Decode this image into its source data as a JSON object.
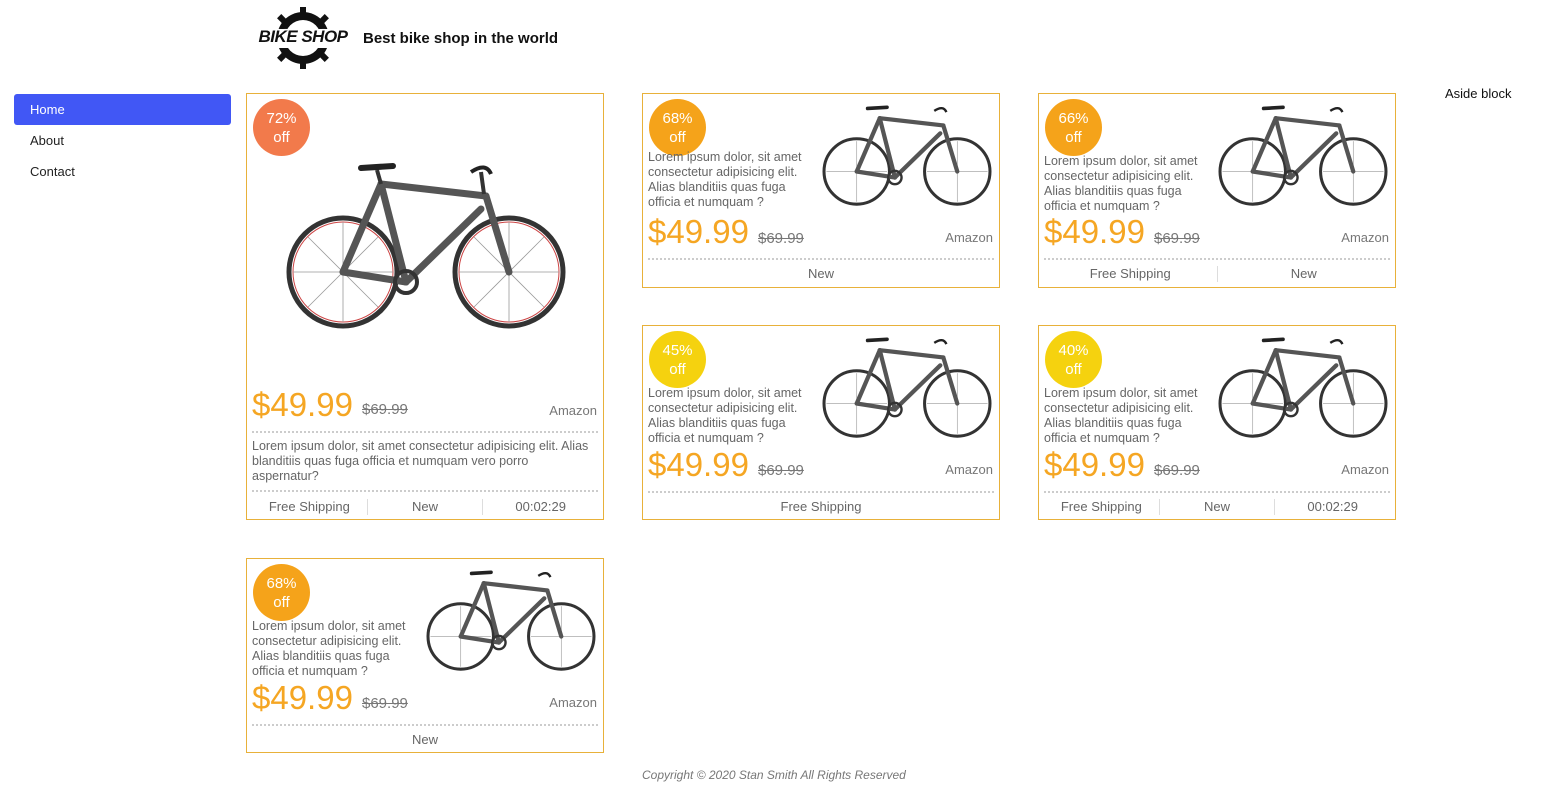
{
  "header": {
    "logo_text": "BIKE SHOP",
    "tagline": "Best bike shop in the world"
  },
  "nav": {
    "items": [
      {
        "label": "Home",
        "active": true
      },
      {
        "label": "About",
        "active": false
      },
      {
        "label": "Contact",
        "active": false
      }
    ]
  },
  "aside": {
    "label": "Aside block"
  },
  "colors": {
    "accent_blue": "#4157f5",
    "price_orange": "#f5a623",
    "card_border": "#e8b13a",
    "badge_72": "#f27a4b",
    "badge_68": "#f5a31a",
    "badge_66": "#f5a31a",
    "badge_45": "#f5d20f",
    "badge_40": "#f5d20f"
  },
  "cards": [
    {
      "badge_pct": "72%",
      "badge_off": "off",
      "price": "$49.99",
      "old_price": "$69.99",
      "store": "Amazon",
      "desc": "Lorem ipsum dolor, sit amet consectetur adipisicing elit. Alias blanditiis quas fuga officia et numquam vero porro aspernatur?",
      "tags": [
        "Free Shipping",
        "New",
        "00:02:29"
      ]
    },
    {
      "badge_pct": "68%",
      "badge_off": "off",
      "price": "$49.99",
      "old_price": "$69.99",
      "store": "Amazon",
      "desc": "Lorem ipsum dolor, sit amet consectetur adipisicing elit. Alias blanditiis quas fuga officia et numquam ?",
      "tags": [
        "New"
      ]
    },
    {
      "badge_pct": "66%",
      "badge_off": "off",
      "price": "$49.99",
      "old_price": "$69.99",
      "store": "Amazon",
      "desc": "Lorem ipsum dolor, sit amet consectetur adipisicing elit. Alias blanditiis quas fuga officia et numquam ?",
      "tags": [
        "Free Shipping",
        "New"
      ]
    },
    {
      "badge_pct": "45%",
      "badge_off": "off",
      "price": "$49.99",
      "old_price": "$69.99",
      "store": "Amazon",
      "desc": "Lorem ipsum dolor, sit amet consectetur adipisicing elit. Alias blanditiis quas fuga officia et numquam ?",
      "tags": [
        "Free Shipping"
      ]
    },
    {
      "badge_pct": "40%",
      "badge_off": "off",
      "price": "$49.99",
      "old_price": "$69.99",
      "store": "Amazon",
      "desc": "Lorem ipsum dolor, sit amet consectetur adipisicing elit. Alias blanditiis quas fuga officia et numquam ?",
      "tags": [
        "Free Shipping",
        "New",
        "00:02:29"
      ]
    },
    {
      "badge_pct": "68%",
      "badge_off": "off",
      "price": "$49.99",
      "old_price": "$69.99",
      "store": "Amazon",
      "desc": "Lorem ipsum dolor, sit amet consectetur adipisicing elit. Alias blanditiis quas fuga officia et numquam ?",
      "tags": [
        "New"
      ]
    }
  ],
  "footer": {
    "copyright": "Copyright © 2020 Stan Smith All Rights Reserved"
  }
}
